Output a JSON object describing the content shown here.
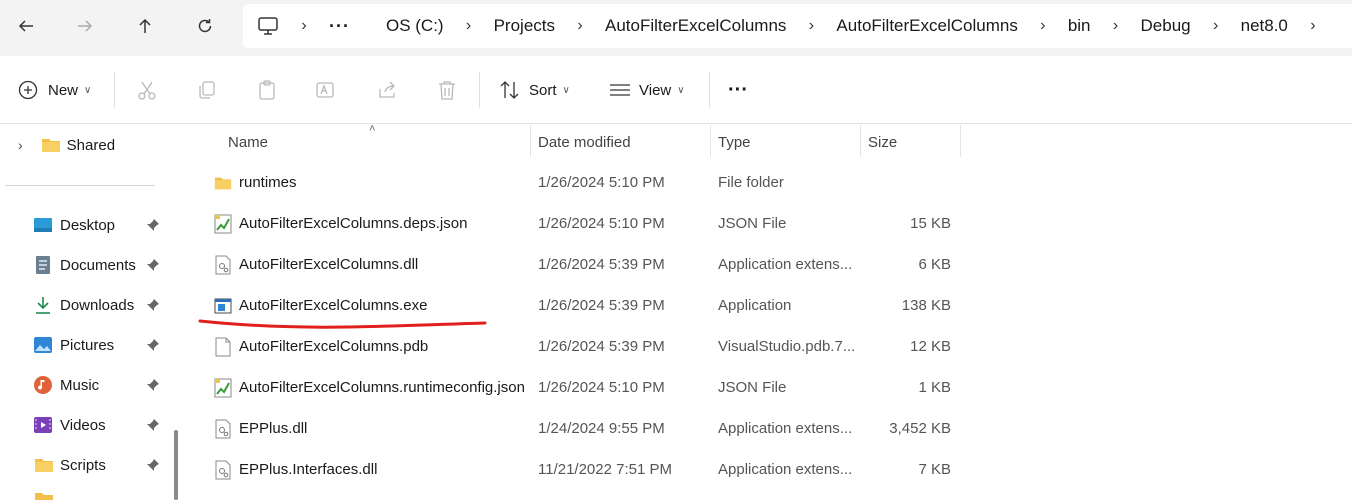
{
  "address": {
    "crumbs": [
      "OS (C:)",
      "Projects",
      "AutoFilterExcelColumns",
      "AutoFilterExcelColumns",
      "bin",
      "Debug",
      "net8.0"
    ],
    "overflow": "···"
  },
  "toolbar": {
    "new_label": "New",
    "sort_label": "Sort",
    "view_label": "View",
    "more": "···"
  },
  "sidebar": {
    "shared": "Shared",
    "items": [
      {
        "label": "Desktop",
        "icon": "desktop-icon"
      },
      {
        "label": "Documents",
        "icon": "documents-icon"
      },
      {
        "label": "Downloads",
        "icon": "downloads-icon"
      },
      {
        "label": "Pictures",
        "icon": "pictures-icon"
      },
      {
        "label": "Music",
        "icon": "music-icon"
      },
      {
        "label": "Videos",
        "icon": "videos-icon"
      },
      {
        "label": "Scripts",
        "icon": "folder-icon"
      }
    ]
  },
  "columns": {
    "name": "Name",
    "date": "Date modified",
    "type": "Type",
    "size": "Size"
  },
  "files": [
    {
      "name": "runtimes",
      "date": "1/26/2024 5:10 PM",
      "type": "File folder",
      "size": "",
      "icon": "folder"
    },
    {
      "name": "AutoFilterExcelColumns.deps.json",
      "date": "1/26/2024 5:10 PM",
      "type": "JSON File",
      "size": "15 KB",
      "icon": "json"
    },
    {
      "name": "AutoFilterExcelColumns.dll",
      "date": "1/26/2024 5:39 PM",
      "type": "Application extens...",
      "size": "6 KB",
      "icon": "dll"
    },
    {
      "name": "AutoFilterExcelColumns.exe",
      "date": "1/26/2024 5:39 PM",
      "type": "Application",
      "size": "138 KB",
      "icon": "exe"
    },
    {
      "name": "AutoFilterExcelColumns.pdb",
      "date": "1/26/2024 5:39 PM",
      "type": "VisualStudio.pdb.7...",
      "size": "12 KB",
      "icon": "file"
    },
    {
      "name": "AutoFilterExcelColumns.runtimeconfig.json",
      "date": "1/26/2024 5:10 PM",
      "type": "JSON File",
      "size": "1 KB",
      "icon": "json"
    },
    {
      "name": "EPPlus.dll",
      "date": "1/24/2024 9:55 PM",
      "type": "Application extens...",
      "size": "3,452 KB",
      "icon": "dll"
    },
    {
      "name": "EPPlus.Interfaces.dll",
      "date": "11/21/2022 7:51 PM",
      "type": "Application extens...",
      "size": "7 KB",
      "icon": "dll"
    }
  ],
  "colors": {
    "accent": "#0067c0",
    "folder": "#f2c04a",
    "annotation": "#e0201c"
  }
}
